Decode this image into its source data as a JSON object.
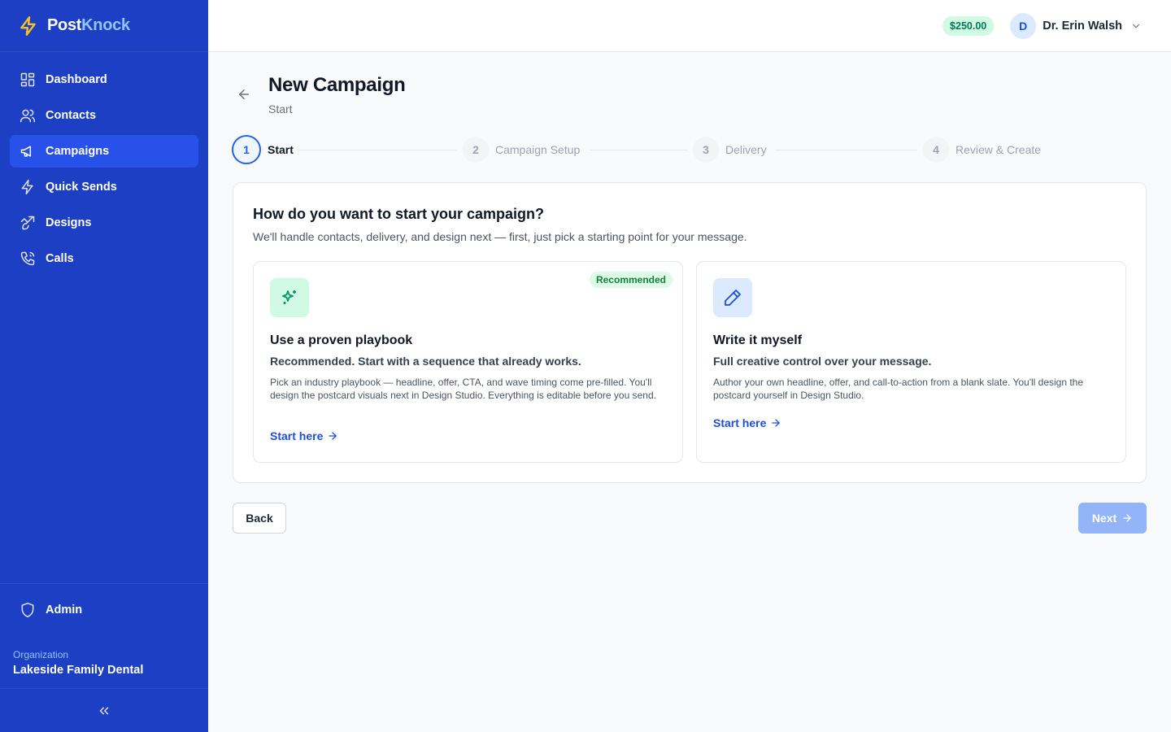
{
  "brand": {
    "part1": "Post",
    "part2": "Knock",
    "icon": "lightning-bolt-icon"
  },
  "sidebar": {
    "items": [
      {
        "label": "Dashboard",
        "icon": "dashboard-icon",
        "active": false
      },
      {
        "label": "Contacts",
        "icon": "users-icon",
        "active": false
      },
      {
        "label": "Campaigns",
        "icon": "megaphone-icon",
        "active": true
      },
      {
        "label": "Quick Sends",
        "icon": "lightning-icon",
        "active": false
      },
      {
        "label": "Designs",
        "icon": "brush-icon",
        "active": false
      },
      {
        "label": "Calls",
        "icon": "phone-icon",
        "active": false
      }
    ],
    "admin_label": "Admin",
    "org_label": "Organization",
    "org_name": "Lakeside Family Dental"
  },
  "topbar": {
    "balance": "$250.00",
    "avatar_initial": "D",
    "user_name": "Dr. Erin Walsh"
  },
  "page": {
    "title": "New Campaign",
    "subtitle": "Start"
  },
  "stepper": {
    "steps": [
      {
        "num": "1",
        "label": "Start",
        "active": true
      },
      {
        "num": "2",
        "label": "Campaign Setup",
        "active": false
      },
      {
        "num": "3",
        "label": "Delivery",
        "active": false
      },
      {
        "num": "4",
        "label": "Review & Create",
        "active": false
      }
    ]
  },
  "card": {
    "title": "How do you want to start your campaign?",
    "description": "We'll handle contacts, delivery, and design next — first, just pick a starting point for your message.",
    "options": [
      {
        "badge": "Recommended",
        "title": "Use a proven playbook",
        "subtitle": "Recommended. Start with a sequence that already works.",
        "body": "Pick an industry playbook — headline, offer, CTA, and wave timing come pre-filled. You'll design the postcard visuals next in Design Studio. Everything is editable before you send.",
        "link": "Start here",
        "icon": "sparkles-icon"
      },
      {
        "title": "Write it myself",
        "subtitle": "Full creative control over your message.",
        "body": "Author your own headline, offer, and call-to-action from a blank slate. You'll design the postcard yourself in Design Studio.",
        "link": "Start here",
        "icon": "pencil-icon"
      }
    ]
  },
  "footer": {
    "back_label": "Back",
    "next_label": "Next"
  },
  "colors": {
    "sidebar_bg": "#1d3fc4",
    "sidebar_active": "#2851ea",
    "accent": "#2563eb",
    "next_disabled": "#93b4f8",
    "badge_green": "#15803d"
  }
}
